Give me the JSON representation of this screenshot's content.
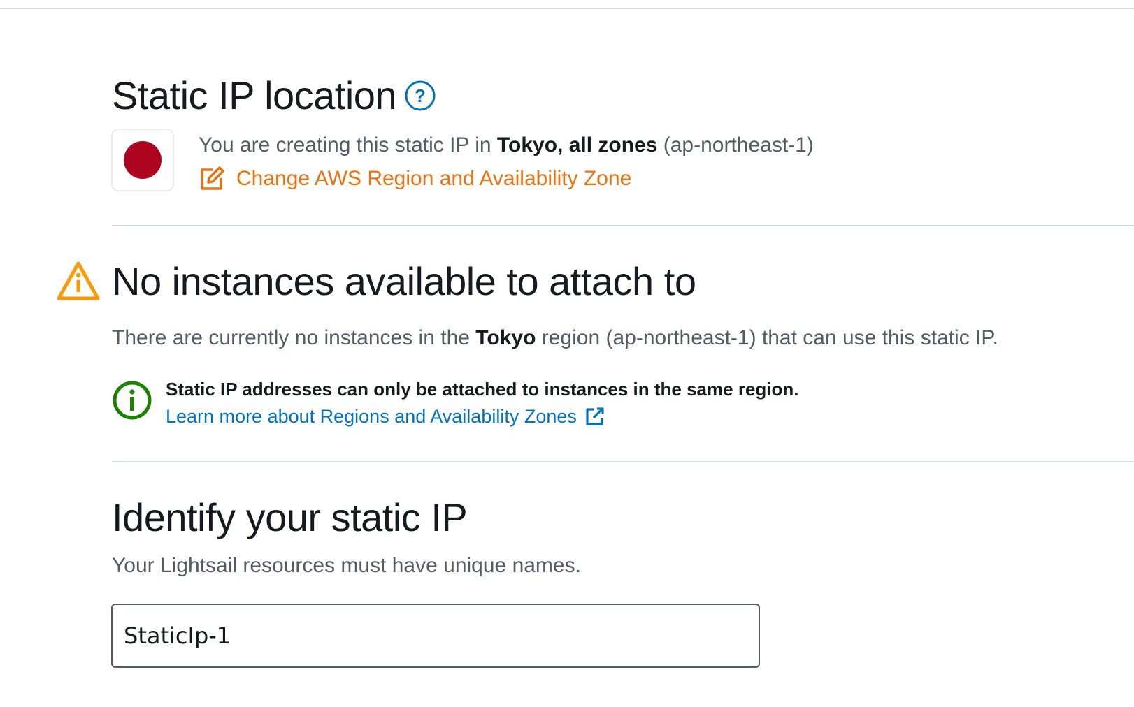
{
  "location": {
    "title": "Static IP location",
    "help_icon": "help-circle-icon",
    "flag_icon": "japan-flag-icon",
    "flag_color": "#ad0520",
    "text_prefix": "You are creating this static IP in ",
    "region_name": "Tokyo, all zones",
    "region_code": " (ap-northeast-1)",
    "change_link_icon": "edit-icon",
    "change_link_label": "Change AWS Region and Availability Zone",
    "accent_color": "#ec7211"
  },
  "no_instances": {
    "icon": "warning-icon",
    "title": "No instances available to attach to",
    "desc_prefix": "There are currently no instances in the ",
    "desc_region": "Tokyo",
    "desc_suffix": " region (ap-northeast-1) that can use this static IP.",
    "info_icon": "info-icon",
    "info_text": "Static IP addresses can only be attached to instances in the same region.",
    "learn_link_label": "Learn more about Regions and Availability Zones",
    "learn_link_icon": "external-link-icon",
    "link_color": "#0073bb"
  },
  "identify": {
    "title": "Identify your static IP",
    "desc": "Your Lightsail resources must have unique names.",
    "name_value": "StaticIp-1"
  }
}
